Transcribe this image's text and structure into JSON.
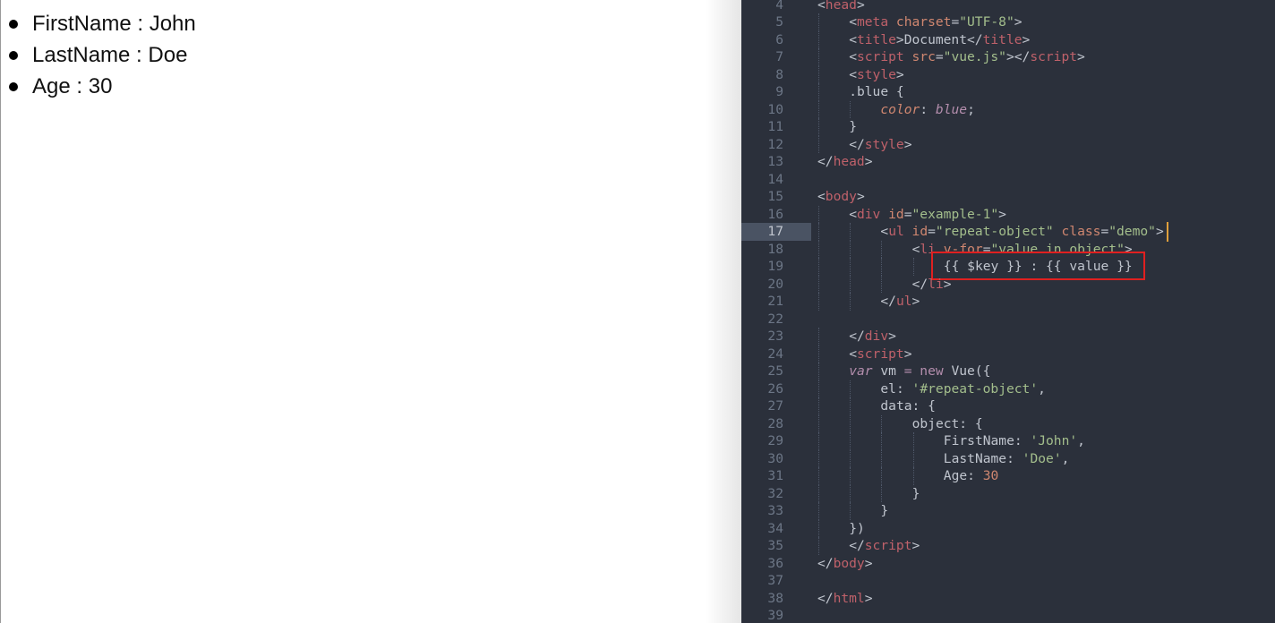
{
  "preview": {
    "items": [
      {
        "key": "FirstName",
        "sep": " : ",
        "value": "John"
      },
      {
        "key": "LastName",
        "sep": " : ",
        "value": "Doe"
      },
      {
        "key": "Age",
        "sep": " : ",
        "value": "30"
      }
    ]
  },
  "editor": {
    "current_line": 17,
    "colors": {
      "background": "#2b303b",
      "tag": "#bf616a",
      "attr": "#d08770",
      "string": "#a3be8c",
      "punct": "#c0c5ce",
      "keyword": "#b48ead",
      "number": "#d08770",
      "selector": "#c0c5ce",
      "highlight": "#e02020"
    },
    "lines": [
      {
        "n": "4",
        "indent": 0,
        "tokens": [
          [
            "p",
            "<"
          ],
          [
            "t",
            "head"
          ],
          [
            "p",
            ">"
          ]
        ]
      },
      {
        "n": "5",
        "indent": 1,
        "tokens": [
          [
            "p",
            "<"
          ],
          [
            "t",
            "meta "
          ],
          [
            "a",
            "charset"
          ],
          [
            "p",
            "="
          ],
          [
            "s",
            "\"UTF-8\""
          ],
          [
            "p",
            ">"
          ]
        ]
      },
      {
        "n": "6",
        "indent": 1,
        "tokens": [
          [
            "p",
            "<"
          ],
          [
            "t",
            "title"
          ],
          [
            "p",
            ">"
          ],
          [
            "x",
            "Document"
          ],
          [
            "p",
            "</"
          ],
          [
            "t",
            "title"
          ],
          [
            "p",
            ">"
          ]
        ]
      },
      {
        "n": "7",
        "indent": 1,
        "tokens": [
          [
            "p",
            "<"
          ],
          [
            "t",
            "script "
          ],
          [
            "a",
            "src"
          ],
          [
            "p",
            "="
          ],
          [
            "s",
            "\"vue.js\""
          ],
          [
            "p",
            "></"
          ],
          [
            "t",
            "script"
          ],
          [
            "p",
            ">"
          ]
        ]
      },
      {
        "n": "8",
        "indent": 1,
        "tokens": [
          [
            "p",
            "<"
          ],
          [
            "t",
            "style"
          ],
          [
            "p",
            ">"
          ]
        ]
      },
      {
        "n": "9",
        "indent": 1,
        "tokens": [
          [
            "x",
            ".blue"
          ],
          [
            "p",
            " {"
          ]
        ]
      },
      {
        "n": "10",
        "indent": 2,
        "tokens": [
          [
            "ai",
            "color"
          ],
          [
            "p",
            ": "
          ],
          [
            "ki",
            "blue"
          ],
          [
            "p",
            ";"
          ]
        ]
      },
      {
        "n": "11",
        "indent": 1,
        "tokens": [
          [
            "p",
            "}"
          ]
        ]
      },
      {
        "n": "12",
        "indent": 1,
        "tokens": [
          [
            "p",
            "</"
          ],
          [
            "t",
            "style"
          ],
          [
            "p",
            ">"
          ]
        ]
      },
      {
        "n": "13",
        "indent": 0,
        "tokens": [
          [
            "p",
            "</"
          ],
          [
            "t",
            "head"
          ],
          [
            "p",
            ">"
          ]
        ]
      },
      {
        "n": "14",
        "indent": 0,
        "tokens": []
      },
      {
        "n": "15",
        "indent": 0,
        "tokens": [
          [
            "p",
            "<"
          ],
          [
            "t",
            "body"
          ],
          [
            "p",
            ">"
          ]
        ]
      },
      {
        "n": "16",
        "indent": 1,
        "tokens": [
          [
            "p",
            "<"
          ],
          [
            "t",
            "div "
          ],
          [
            "a",
            "id"
          ],
          [
            "p",
            "="
          ],
          [
            "s",
            "\"example-1\""
          ],
          [
            "p",
            ">"
          ]
        ]
      },
      {
        "n": "17",
        "indent": 2,
        "tokens": [
          [
            "p",
            "<"
          ],
          [
            "t",
            "ul "
          ],
          [
            "a",
            "id"
          ],
          [
            "p",
            "="
          ],
          [
            "s",
            "\"repeat-object\""
          ],
          [
            "a",
            " class"
          ],
          [
            "p",
            "="
          ],
          [
            "s",
            "\"demo\""
          ],
          [
            "p",
            ">"
          ]
        ]
      },
      {
        "n": "18",
        "indent": 3,
        "tokens": [
          [
            "p",
            "<"
          ],
          [
            "t",
            "li "
          ],
          [
            "a",
            "v-for"
          ],
          [
            "p",
            "="
          ],
          [
            "s",
            "\"value in object\""
          ],
          [
            "p",
            ">"
          ]
        ]
      },
      {
        "n": "19",
        "indent": 4,
        "tokens": [
          [
            "x",
            "{{ $key }} : {{ value }}"
          ]
        ]
      },
      {
        "n": "20",
        "indent": 3,
        "tokens": [
          [
            "p",
            "</"
          ],
          [
            "t",
            "li"
          ],
          [
            "p",
            ">"
          ]
        ]
      },
      {
        "n": "21",
        "indent": 2,
        "tokens": [
          [
            "p",
            "</"
          ],
          [
            "t",
            "ul"
          ],
          [
            "p",
            ">"
          ]
        ]
      },
      {
        "n": "22",
        "indent": 0,
        "tokens": []
      },
      {
        "n": "23",
        "indent": 1,
        "tokens": [
          [
            "p",
            "</"
          ],
          [
            "t",
            "div"
          ],
          [
            "p",
            ">"
          ]
        ]
      },
      {
        "n": "24",
        "indent": 1,
        "tokens": [
          [
            "p",
            "<"
          ],
          [
            "t",
            "script"
          ],
          [
            "p",
            ">"
          ]
        ]
      },
      {
        "n": "25",
        "indent": 1,
        "tokens": [
          [
            "ki",
            "var"
          ],
          [
            "x",
            " vm "
          ],
          [
            "k",
            "="
          ],
          [
            "k",
            " new"
          ],
          [
            "x",
            " Vue({"
          ]
        ]
      },
      {
        "n": "26",
        "indent": 2,
        "tokens": [
          [
            "x",
            "el: "
          ],
          [
            "s",
            "'#repeat-object'"
          ],
          [
            "x",
            ","
          ]
        ]
      },
      {
        "n": "27",
        "indent": 2,
        "tokens": [
          [
            "x",
            "data: {"
          ]
        ]
      },
      {
        "n": "28",
        "indent": 3,
        "tokens": [
          [
            "x",
            "object: {"
          ]
        ]
      },
      {
        "n": "29",
        "indent": 4,
        "tokens": [
          [
            "x",
            "FirstName: "
          ],
          [
            "s",
            "'John'"
          ],
          [
            "x",
            ","
          ]
        ]
      },
      {
        "n": "30",
        "indent": 4,
        "tokens": [
          [
            "x",
            "LastName: "
          ],
          [
            "s",
            "'Doe'"
          ],
          [
            "x",
            ","
          ]
        ]
      },
      {
        "n": "31",
        "indent": 4,
        "tokens": [
          [
            "x",
            "Age: "
          ],
          [
            "num",
            "30"
          ]
        ]
      },
      {
        "n": "32",
        "indent": 3,
        "tokens": [
          [
            "x",
            "}"
          ]
        ]
      },
      {
        "n": "33",
        "indent": 2,
        "tokens": [
          [
            "x",
            "}"
          ]
        ]
      },
      {
        "n": "34",
        "indent": 1,
        "tokens": [
          [
            "x",
            "})"
          ]
        ]
      },
      {
        "n": "35",
        "indent": 1,
        "tokens": [
          [
            "p",
            "</"
          ],
          [
            "t",
            "script"
          ],
          [
            "p",
            ">"
          ]
        ]
      },
      {
        "n": "36",
        "indent": 0,
        "tokens": [
          [
            "p",
            "</"
          ],
          [
            "t",
            "body"
          ],
          [
            "p",
            ">"
          ]
        ]
      },
      {
        "n": "37",
        "indent": 0,
        "tokens": []
      },
      {
        "n": "38",
        "indent": 0,
        "tokens": [
          [
            "p",
            "</"
          ],
          [
            "t",
            "html"
          ],
          [
            "p",
            ">"
          ]
        ]
      },
      {
        "n": "39",
        "indent": 0,
        "tokens": []
      }
    ]
  }
}
